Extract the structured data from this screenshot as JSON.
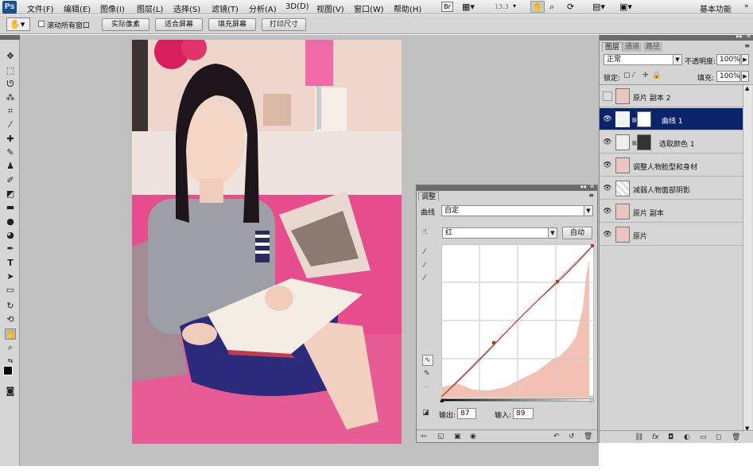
{
  "app": {
    "logo_text": "Ps"
  },
  "menu": [
    "文件(F)",
    "编辑(E)",
    "图像(I)",
    "图层(L)",
    "选择(S)",
    "滤镜(T)",
    "分析(A)",
    "3D(D)",
    "视图(V)",
    "窗口(W)",
    "帮助(H)"
  ],
  "menu_right": {
    "br_label": "Br",
    "zoom": "13.3",
    "workspace": "基本功能"
  },
  "options": {
    "scroll_all_label": "滚动所有窗口",
    "btn_actual": "实际像素",
    "btn_fit": "适合屏幕",
    "btn_fill": "填充屏幕",
    "btn_print": "打印尺寸"
  },
  "adjustments": {
    "tab": "调整",
    "preset_label": "曲线",
    "preset_value": "自定",
    "channel_value": "红",
    "auto_label": "自动",
    "output_label": "输出:",
    "output_value": "87",
    "input_label": "输入:",
    "input_value": "89"
  },
  "layers_panel": {
    "tabs": [
      "图层",
      "通道",
      "路径"
    ],
    "blend_mode": "正常",
    "opacity_label": "不透明度:",
    "opacity_value": "100%",
    "lock_label": "锁定:",
    "fill_label": "填充:",
    "fill_value": "100%",
    "layers": [
      {
        "name": "原片 副本 2",
        "visible": false,
        "active": false
      },
      {
        "name": "曲线 1",
        "visible": true,
        "active": true
      },
      {
        "name": "选取颜色 1",
        "visible": true,
        "active": false
      },
      {
        "name": "调整人物脸型和身材",
        "visible": true,
        "active": false
      },
      {
        "name": "减弱人物面部阴影",
        "visible": true,
        "active": false
      },
      {
        "name": "原片 副本",
        "visible": true,
        "active": false
      },
      {
        "name": "原片",
        "visible": true,
        "active": false
      }
    ]
  },
  "icons": [
    "hand-icon",
    "zoom-icon",
    "rotate-view-icon",
    "move-icon",
    "marquee-icon",
    "lasso-icon",
    "quick-select-icon",
    "crop-icon",
    "eyedropper-icon",
    "healing-icon",
    "brush-icon",
    "stamp-icon",
    "history-brush-icon",
    "eraser-icon",
    "gradient-icon",
    "blur-icon",
    "dodge-icon",
    "pen-icon",
    "type-icon",
    "path-select-icon",
    "shape-icon",
    "3d-rotate-icon",
    "3d-camera-icon",
    "hand-tool-icon",
    "zoom-tool-icon"
  ],
  "colors": {
    "active_layer": "#0a246a",
    "curve_line": "#c0392b",
    "histogram": "#f3c1b3",
    "workspace_bg": "#c0c0c0"
  }
}
